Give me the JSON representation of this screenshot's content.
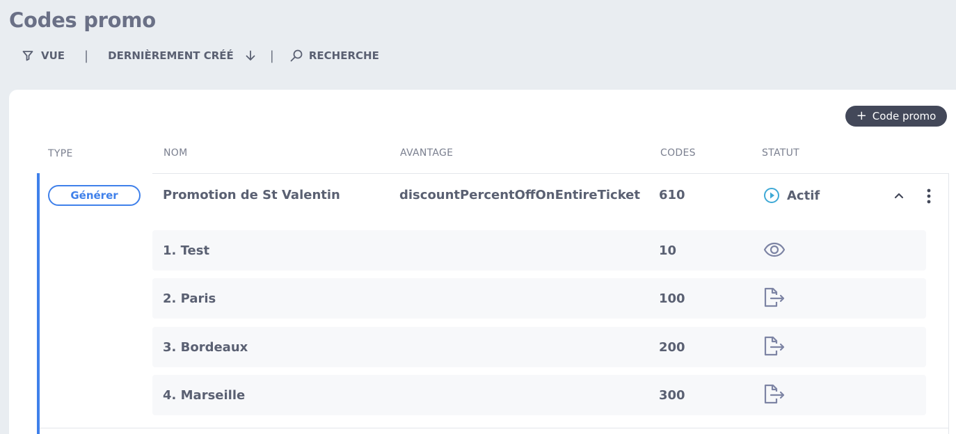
{
  "header": {
    "title": "Codes promo"
  },
  "toolbar": {
    "view_label": "VUE",
    "separator": "|",
    "sort_label": "DERNIÈREMENT CRÉÉ",
    "search_label": "RECHERCHE",
    "icons": {
      "view": "filter-icon",
      "sort": "arrow-down-icon",
      "search": "search-icon"
    }
  },
  "add_button": {
    "label": "Code promo",
    "icon": "plus-icon"
  },
  "table": {
    "columns": {
      "type": "TYPE",
      "name": "NOM",
      "advantage": "AVANTAGE",
      "codes": "CODES",
      "status": "STATUT"
    },
    "promotion": {
      "type": "Générer",
      "name": "Promotion de St Valentin",
      "advantage": "discountPercentOffOnEntireTicket",
      "codes": "610",
      "status": "Actif",
      "status_icon": "play-circle-icon",
      "accent": "#3f80ea",
      "batches": [
        {
          "name": "1. Test",
          "codes": "10",
          "action_icon": "eye-icon"
        },
        {
          "name": "2. Paris",
          "codes": "100",
          "action_icon": "file-export-icon"
        },
        {
          "name": "3. Bordeaux",
          "codes": "200",
          "action_icon": "file-export-icon"
        },
        {
          "name": "4. Marseille",
          "codes": "300",
          "action_icon": "file-export-icon"
        }
      ]
    }
  }
}
